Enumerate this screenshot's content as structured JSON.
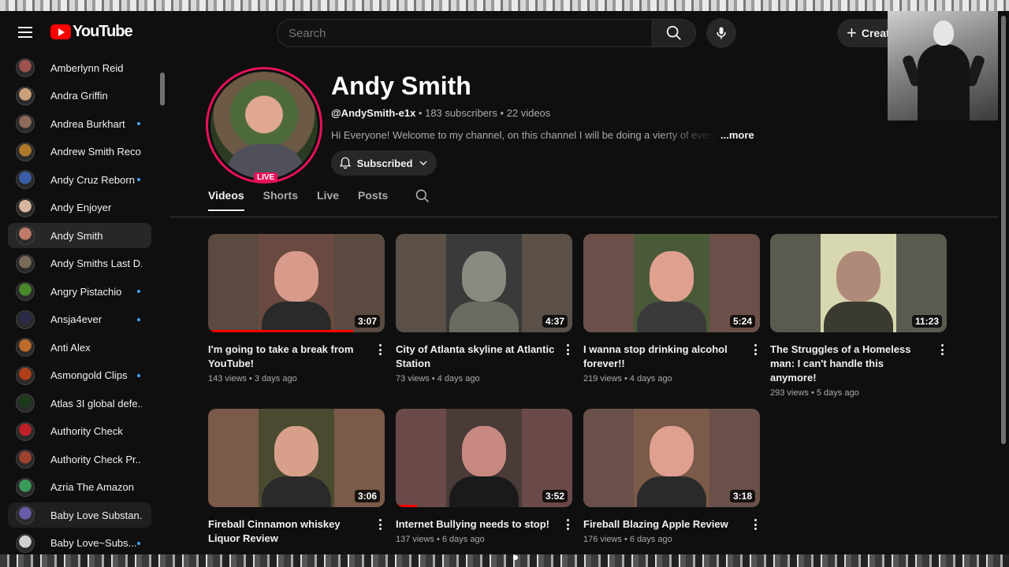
{
  "header": {
    "logo_text": "YouTube",
    "search_placeholder": "Search",
    "create_label": "Creat"
  },
  "sidebar": {
    "items": [
      {
        "label": "Amberlynn Reid",
        "dot": false,
        "color": "#a0524d"
      },
      {
        "label": "Andra Griffin",
        "dot": false,
        "color": "#c9a07a"
      },
      {
        "label": "Andrea Burkhart",
        "dot": true,
        "color": "#8c6b5a"
      },
      {
        "label": "Andrew Smith Reco...",
        "dot": false,
        "color": "#b07a2a"
      },
      {
        "label": "Andy Cruz Reborn",
        "dot": true,
        "color": "#3a5fa8"
      },
      {
        "label": "Andy Enjoyer",
        "dot": false,
        "color": "#d8b7a0"
      },
      {
        "label": "Andy Smith",
        "dot": false,
        "color": "#c07a68"
      },
      {
        "label": "Andy Smiths Last D...",
        "dot": false,
        "color": "#7a6a5a"
      },
      {
        "label": "Angry Pistachio",
        "dot": true,
        "color": "#4a8a2a"
      },
      {
        "label": "Ansja4ever",
        "dot": true,
        "color": "#2a2a4a"
      },
      {
        "label": "Anti Alex",
        "dot": false,
        "color": "#c06a2a"
      },
      {
        "label": "Asmongold Clips",
        "dot": true,
        "color": "#b0401a"
      },
      {
        "label": "Atlas 3I global defe...",
        "dot": false,
        "color": "#1a3a1a"
      },
      {
        "label": "Authority Check",
        "dot": false,
        "color": "#c0202a"
      },
      {
        "label": "Authority Check Pr...",
        "dot": false,
        "color": "#a04030"
      },
      {
        "label": "Azria The Amazon",
        "dot": false,
        "color": "#3a9a5a"
      },
      {
        "label": "Baby Love Substan...",
        "dot": false,
        "color": "#6a5aaa"
      },
      {
        "label": "Baby Love~Subs...",
        "dot": true,
        "color": "#d0d0d0"
      }
    ]
  },
  "channel": {
    "name": "Andy Smith",
    "handle": "@AndySmith-e1x",
    "stats": " • 183 subscribers • 22 videos",
    "description": "Hi Everyone! Welcome to my channel, on this channel I will be doing a vierty of everything",
    "more_label": "...more",
    "live_badge": "LIVE",
    "subscribed_label": "Subscribed"
  },
  "tabs": [
    {
      "label": "Videos"
    },
    {
      "label": "Shorts"
    },
    {
      "label": "Live"
    },
    {
      "label": "Posts"
    }
  ],
  "videos": [
    {
      "title": "I'm going to take a break from YouTube!",
      "meta": "143 views • 3 days ago",
      "duration": "3:07",
      "progress": 0.82,
      "bg": "#5a4a40",
      "center": "#6a4a40",
      "face": "#d89a8a",
      "body": "#2a2a2a"
    },
    {
      "title": "City of Atlanta skyline at Atlantic Station",
      "meta": "73 views • 4 days ago",
      "duration": "4:37",
      "progress": 0,
      "bg": "#5a5048",
      "center": "#3a3a3a",
      "face": "#8a8a80",
      "body": "#6a6a60"
    },
    {
      "title": "I wanna stop drinking alcohol forever!!",
      "meta": "219 views • 4 days ago",
      "duration": "5:24",
      "progress": 0,
      "bg": "#6a5048",
      "center": "#4a5a38",
      "face": "#e0a090",
      "body": "#3a3a3a"
    },
    {
      "title": "The Struggles of a Homeless man: I can't handle this anymore!",
      "meta": "293 views • 5 days ago",
      "duration": "11:23",
      "progress": 0,
      "bg": "#5a5a50",
      "center": "#d8d8b0",
      "face": "#b08a78",
      "body": "#3a3a30"
    },
    {
      "title": "Fireball Cinnamon whiskey Liquor Review",
      "meta": "",
      "duration": "3:06",
      "progress": 0,
      "bg": "#7a5a48",
      "center": "#4a4a30",
      "face": "#d8a08a",
      "body": "#2a2a2a"
    },
    {
      "title": "Internet Bullying needs to stop!",
      "meta": "137 views • 6 days ago",
      "duration": "3:52",
      "progress": 0.12,
      "bg": "#6a4a48",
      "center": "#4a3a38",
      "face": "#c88a80",
      "body": "#1a1a1a"
    },
    {
      "title": "Fireball Blazing Apple Review",
      "meta": "176 views • 6 days ago",
      "duration": "3:18",
      "progress": 0,
      "bg": "#6a5048",
      "center": "#7a5a48",
      "face": "#e0a090",
      "body": "#2a2a2a"
    }
  ],
  "colors": {
    "accent": "#ff0000",
    "live_ring": "#e8115b",
    "new_dot": "#3ea6ff"
  }
}
